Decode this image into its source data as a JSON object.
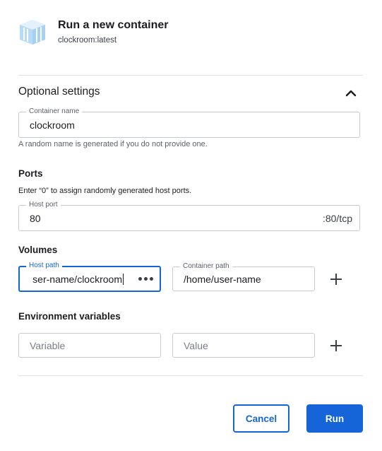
{
  "header": {
    "title": "Run a new container",
    "image": "clockroom:latest",
    "logo_icon": "container-image-icon"
  },
  "optional_settings": {
    "title": "Optional settings",
    "expanded": true,
    "container_name": {
      "label": "Container name",
      "value": "clockroom",
      "helper": "A random name is generated if you do not provide one."
    }
  },
  "ports": {
    "title": "Ports",
    "note": "Enter “0” to assign randomly generated host ports.",
    "host_port": {
      "label": "Host port",
      "value": "80",
      "suffix": ":80/tcp"
    }
  },
  "volumes": {
    "title": "Volumes",
    "host_path": {
      "label": "Host path",
      "value": "ser-name/clockroom"
    },
    "container_path": {
      "label": "Container path",
      "value": "/home/user-name"
    }
  },
  "env": {
    "title": "Environment variables",
    "variable_placeholder": "Variable",
    "value_placeholder": "Value"
  },
  "actions": {
    "cancel": "Cancel",
    "run": "Run"
  },
  "colors": {
    "accent": "#1565d8",
    "logo": "#b3d9f7"
  }
}
